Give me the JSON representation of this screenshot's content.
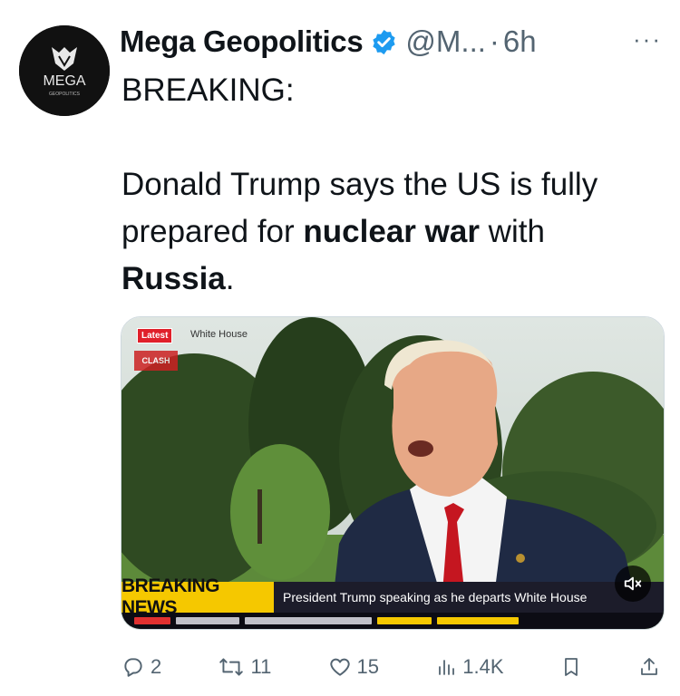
{
  "tweet": {
    "author_name": "Mega Geopolitics",
    "handle": "@M...",
    "separator": "·",
    "time": "6h",
    "more": "···",
    "avatar_text": "MEGA",
    "avatar_subtext": "GEOPOLITICS",
    "line1": "BREAKING:",
    "body_1": "Donald Trump says the US is fully prepared for ",
    "body_bold_1": "nuclear war",
    "body_2": " with ",
    "body_bold_2": "Russia",
    "body_3": "."
  },
  "media": {
    "latest_label": "Latest",
    "location_label": "White House",
    "clash_label": "CLASH",
    "breaking_label": "BREAKING NEWS",
    "headline": "President Trump speaking as he departs White House",
    "mute_icon": "speaker-muted-icon"
  },
  "actions": {
    "replies": "2",
    "reposts": "11",
    "likes": "15",
    "views": "1.4K"
  },
  "colors": {
    "verified_blue": "#1d9bf0",
    "muted_text": "#536471",
    "breaking_yellow": "#f5c800"
  }
}
